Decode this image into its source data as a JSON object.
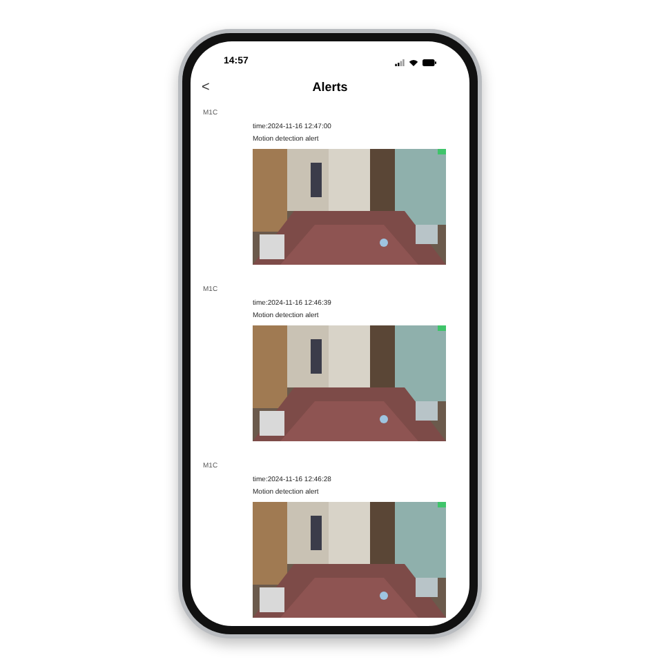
{
  "status_bar": {
    "time": "14:57"
  },
  "header": {
    "back": "<",
    "title": "Alerts"
  },
  "alerts": [
    {
      "device": "M1C",
      "time": "time:2024-11-16 12:47:00",
      "message": "Motion detection alert"
    },
    {
      "device": "M1C",
      "time": "time:2024-11-16 12:46:39",
      "message": "Motion detection alert"
    },
    {
      "device": "M1C",
      "time": "time:2024-11-16 12:46:28",
      "message": "Motion detection alert"
    }
  ]
}
